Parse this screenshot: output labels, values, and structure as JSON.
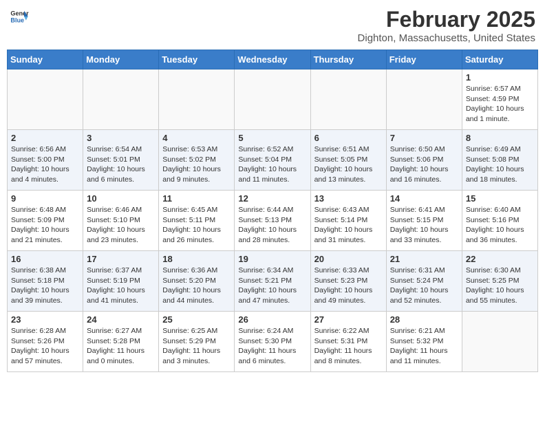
{
  "header": {
    "logo_general": "General",
    "logo_blue": "Blue",
    "month_title": "February 2025",
    "location": "Dighton, Massachusetts, United States"
  },
  "weekdays": [
    "Sunday",
    "Monday",
    "Tuesday",
    "Wednesday",
    "Thursday",
    "Friday",
    "Saturday"
  ],
  "weeks": [
    [
      {
        "day": null
      },
      {
        "day": null
      },
      {
        "day": null
      },
      {
        "day": null
      },
      {
        "day": null
      },
      {
        "day": null
      },
      {
        "day": 1,
        "sunrise": "6:57 AM",
        "sunset": "4:59 PM",
        "daylight": "10 hours and 1 minute."
      }
    ],
    [
      {
        "day": 2,
        "sunrise": "6:56 AM",
        "sunset": "5:00 PM",
        "daylight": "10 hours and 4 minutes."
      },
      {
        "day": 3,
        "sunrise": "6:54 AM",
        "sunset": "5:01 PM",
        "daylight": "10 hours and 6 minutes."
      },
      {
        "day": 4,
        "sunrise": "6:53 AM",
        "sunset": "5:02 PM",
        "daylight": "10 hours and 9 minutes."
      },
      {
        "day": 5,
        "sunrise": "6:52 AM",
        "sunset": "5:04 PM",
        "daylight": "10 hours and 11 minutes."
      },
      {
        "day": 6,
        "sunrise": "6:51 AM",
        "sunset": "5:05 PM",
        "daylight": "10 hours and 13 minutes."
      },
      {
        "day": 7,
        "sunrise": "6:50 AM",
        "sunset": "5:06 PM",
        "daylight": "10 hours and 16 minutes."
      },
      {
        "day": 8,
        "sunrise": "6:49 AM",
        "sunset": "5:08 PM",
        "daylight": "10 hours and 18 minutes."
      }
    ],
    [
      {
        "day": 9,
        "sunrise": "6:48 AM",
        "sunset": "5:09 PM",
        "daylight": "10 hours and 21 minutes."
      },
      {
        "day": 10,
        "sunrise": "6:46 AM",
        "sunset": "5:10 PM",
        "daylight": "10 hours and 23 minutes."
      },
      {
        "day": 11,
        "sunrise": "6:45 AM",
        "sunset": "5:11 PM",
        "daylight": "10 hours and 26 minutes."
      },
      {
        "day": 12,
        "sunrise": "6:44 AM",
        "sunset": "5:13 PM",
        "daylight": "10 hours and 28 minutes."
      },
      {
        "day": 13,
        "sunrise": "6:43 AM",
        "sunset": "5:14 PM",
        "daylight": "10 hours and 31 minutes."
      },
      {
        "day": 14,
        "sunrise": "6:41 AM",
        "sunset": "5:15 PM",
        "daylight": "10 hours and 33 minutes."
      },
      {
        "day": 15,
        "sunrise": "6:40 AM",
        "sunset": "5:16 PM",
        "daylight": "10 hours and 36 minutes."
      }
    ],
    [
      {
        "day": 16,
        "sunrise": "6:38 AM",
        "sunset": "5:18 PM",
        "daylight": "10 hours and 39 minutes."
      },
      {
        "day": 17,
        "sunrise": "6:37 AM",
        "sunset": "5:19 PM",
        "daylight": "10 hours and 41 minutes."
      },
      {
        "day": 18,
        "sunrise": "6:36 AM",
        "sunset": "5:20 PM",
        "daylight": "10 hours and 44 minutes."
      },
      {
        "day": 19,
        "sunrise": "6:34 AM",
        "sunset": "5:21 PM",
        "daylight": "10 hours and 47 minutes."
      },
      {
        "day": 20,
        "sunrise": "6:33 AM",
        "sunset": "5:23 PM",
        "daylight": "10 hours and 49 minutes."
      },
      {
        "day": 21,
        "sunrise": "6:31 AM",
        "sunset": "5:24 PM",
        "daylight": "10 hours and 52 minutes."
      },
      {
        "day": 22,
        "sunrise": "6:30 AM",
        "sunset": "5:25 PM",
        "daylight": "10 hours and 55 minutes."
      }
    ],
    [
      {
        "day": 23,
        "sunrise": "6:28 AM",
        "sunset": "5:26 PM",
        "daylight": "10 hours and 57 minutes."
      },
      {
        "day": 24,
        "sunrise": "6:27 AM",
        "sunset": "5:28 PM",
        "daylight": "11 hours and 0 minutes."
      },
      {
        "day": 25,
        "sunrise": "6:25 AM",
        "sunset": "5:29 PM",
        "daylight": "11 hours and 3 minutes."
      },
      {
        "day": 26,
        "sunrise": "6:24 AM",
        "sunset": "5:30 PM",
        "daylight": "11 hours and 6 minutes."
      },
      {
        "day": 27,
        "sunrise": "6:22 AM",
        "sunset": "5:31 PM",
        "daylight": "11 hours and 8 minutes."
      },
      {
        "day": 28,
        "sunrise": "6:21 AM",
        "sunset": "5:32 PM",
        "daylight": "11 hours and 11 minutes."
      },
      {
        "day": null
      }
    ]
  ],
  "labels": {
    "sunrise": "Sunrise:",
    "sunset": "Sunset:",
    "daylight": "Daylight:"
  }
}
